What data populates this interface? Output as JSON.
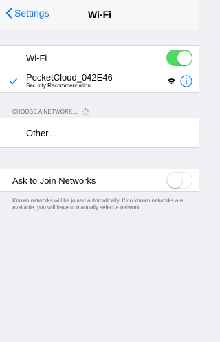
{
  "nav": {
    "back_label": "Settings",
    "title": "Wi-Fi"
  },
  "wifi": {
    "label": "Wi-Fi",
    "enabled": true
  },
  "connected_network": {
    "name": "PocketCloud_042E46",
    "subtitle": "Security Recommendation"
  },
  "choose_network": {
    "header": "CHOOSE A NETWORK...",
    "other_label": "Other..."
  },
  "ask_to_join": {
    "label": "Ask to Join Networks",
    "enabled": false,
    "footer": "Known networks will be joined automatically. If no known networks are available, you will have to manually select a network."
  },
  "colors": {
    "accent": "#007aff",
    "toggle_on": "#4cd964",
    "background": "#efeff4"
  }
}
